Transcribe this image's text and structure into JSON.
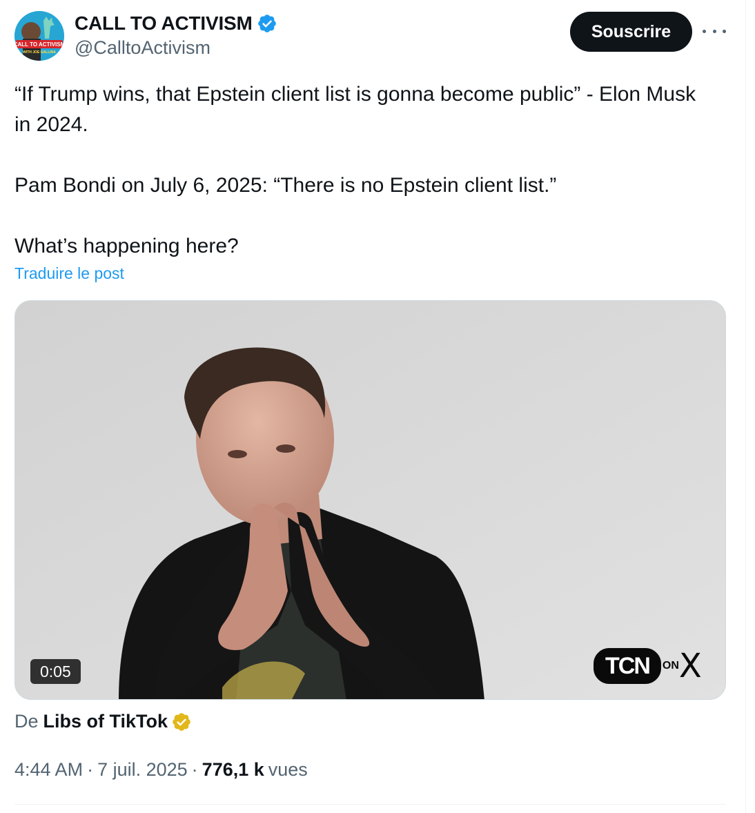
{
  "author": {
    "display_name": "CALL TO ACTIVISM",
    "handle": "@CalltoActivism",
    "avatar_text": "CALL TO ACTIVISM",
    "avatar_subtext": "WITH JOE GALLINA",
    "verified": true,
    "verified_color": "#1d9bf0"
  },
  "actions": {
    "subscribe_label": "Souscrire",
    "more_icon": "more-horizontal-icon"
  },
  "post": {
    "paragraph_1": "“If Trump wins, that Epstein client list is gonna become public” - Elon Musk in 2024.",
    "paragraph_2": "Pam Bondi on July 6, 2025: “There is no Epstein client list.”",
    "paragraph_3": "What’s happening here?",
    "translate_label": "Traduire le post"
  },
  "media": {
    "duration": "0:05",
    "watermark_main": "TCN",
    "watermark_on": "ON",
    "watermark_x": "X",
    "play_icon": "video-thumbnail"
  },
  "source": {
    "prefix": "De",
    "name": "Libs of TikTok",
    "badge_color": "#e2b719"
  },
  "meta": {
    "time": "4:44 AM",
    "separator": "·",
    "date": "7 juil. 2025",
    "views_count": "776,1 k",
    "views_label": "vues"
  },
  "colors": {
    "accent": "#1d9bf0",
    "text_primary": "#0f1419",
    "text_secondary": "#536471"
  }
}
